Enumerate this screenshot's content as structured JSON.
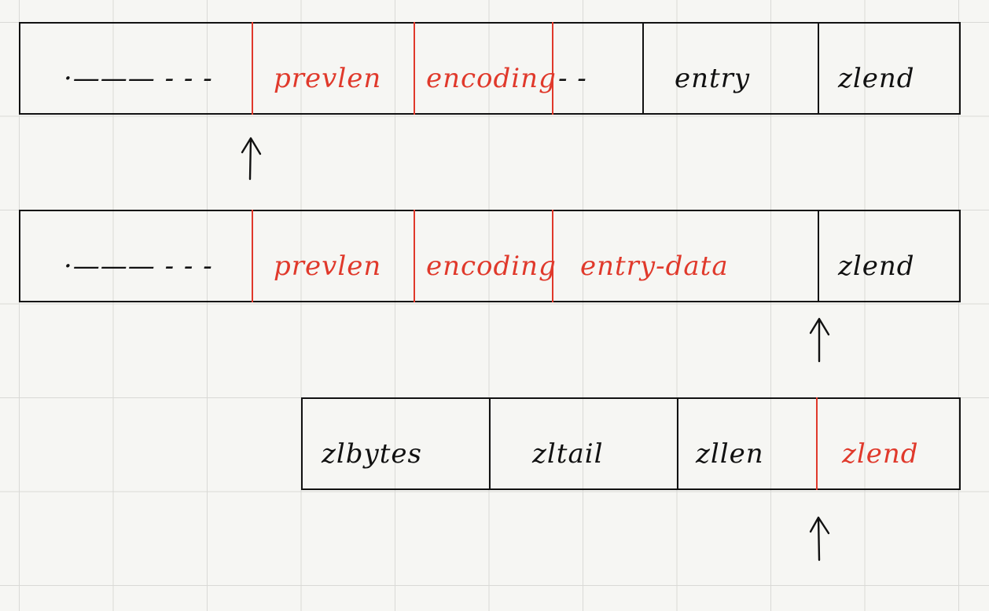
{
  "rows": [
    {
      "cells": [
        "·——— - - -",
        "prevlen",
        "encoding",
        "- -",
        "entry",
        "zlend"
      ]
    },
    {
      "cells": [
        "·——— - - -",
        "prevlen",
        "encoding",
        "entry-data",
        "zlend"
      ]
    },
    {
      "cells": [
        "zlbytes",
        "zltail",
        "zllen",
        "zlend"
      ]
    }
  ],
  "colors": {
    "ink": "#111111",
    "red": "#e0392b",
    "paper": "#f6f6f3",
    "grid": "#d9d9d6"
  },
  "icons": [
    "up-arrow-icon"
  ]
}
